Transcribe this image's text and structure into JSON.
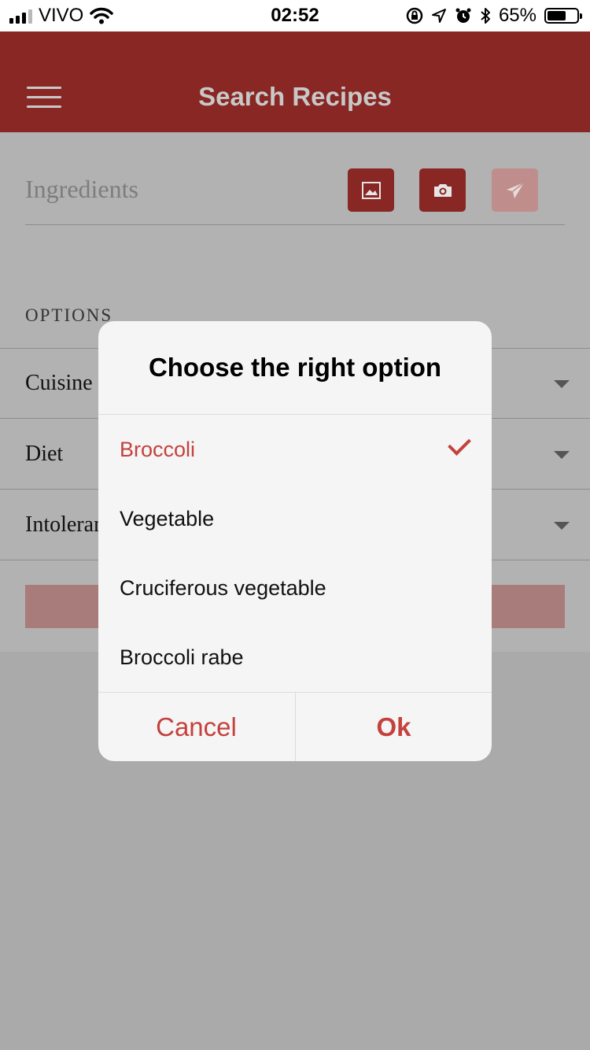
{
  "status_bar": {
    "carrier": "VIVO",
    "time": "02:52",
    "battery": "65%",
    "battery_level": 0.65
  },
  "header": {
    "title": "Search Recipes",
    "menu_icon": "hamburger-menu-icon"
  },
  "search": {
    "placeholder": "Ingredients",
    "buttons": [
      {
        "icon": "image-icon"
      },
      {
        "icon": "camera-icon"
      },
      {
        "icon": "send-icon",
        "disabled": true
      }
    ]
  },
  "options": {
    "section_label": "OPTIONS",
    "rows": [
      {
        "label": "Cuisine"
      },
      {
        "label": "Diet"
      },
      {
        "label": "Intolerances"
      }
    ]
  },
  "dialog": {
    "title": "Choose the right option",
    "options": [
      {
        "label": "Broccoli",
        "selected": true
      },
      {
        "label": "Vegetable",
        "selected": false
      },
      {
        "label": "Cruciferous vegetable",
        "selected": false
      },
      {
        "label": "Broccoli rabe",
        "selected": false
      }
    ],
    "cancel_label": "Cancel",
    "ok_label": "Ok"
  },
  "colors": {
    "brand": "#882723",
    "accent": "#c4413d",
    "overlay": "#aaaaaa"
  }
}
